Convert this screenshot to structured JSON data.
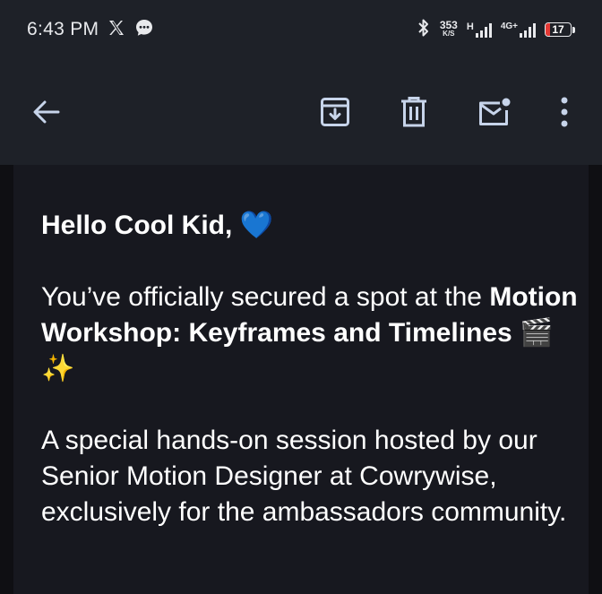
{
  "status_bar": {
    "time": "6:43 PM",
    "net_speed_value": "353",
    "net_speed_unit": "K/S",
    "network_type": "4G+",
    "hd_label": "H",
    "battery_level": "17",
    "battery_fraction": 0.17,
    "battery_color": "#e53935"
  },
  "toolbar": {
    "back_icon": "arrow-left",
    "archive_icon": "archive",
    "delete_icon": "trash",
    "mark_unread_icon": "mail-unread",
    "more_icon": "more-vertical"
  },
  "email": {
    "greeting": "Hello Cool Kid, 💙",
    "para1_prefix": "You’ve officially secured a spot at the ",
    "para1_bold": "Motion Workshop: Keyframes and Timelines",
    "para1_emoji": " 🎬✨",
    "para2": "A special hands-on session hosted by our Senior Motion Designer at Cowrywise, exclusively for the ambassadors community."
  },
  "colors": {
    "bar_background": "#1e2128",
    "page_background": "#0f0f13",
    "card_background": "#17181f",
    "icon_color": "#c7d4ea"
  }
}
